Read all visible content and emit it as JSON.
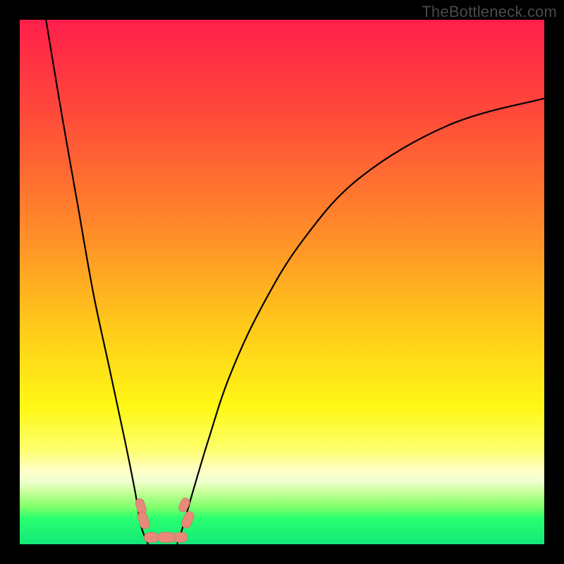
{
  "watermark": "TheBottleneck.com",
  "colors": {
    "black": "#000000",
    "curve": "#000000",
    "blob_fill": "#e88a7a",
    "blob_stroke": "#d97768"
  },
  "chart_data": {
    "type": "line",
    "title": "",
    "xlabel": "",
    "ylabel": "",
    "xlim": [
      0,
      100
    ],
    "ylim": [
      0,
      100
    ],
    "grid": false,
    "series": [
      {
        "name": "left-branch",
        "x": [
          5,
          8,
          11,
          14,
          17,
          20,
          22,
          23,
          24,
          24.5
        ],
        "y": [
          100,
          82,
          65,
          48,
          34,
          20,
          10,
          4,
          1,
          0
        ]
      },
      {
        "name": "right-branch",
        "x": [
          30,
          31,
          33,
          36,
          40,
          46,
          54,
          65,
          82,
          100
        ],
        "y": [
          0,
          3,
          10,
          20,
          32,
          45,
          58,
          70,
          80,
          85
        ]
      }
    ],
    "annotations": [
      {
        "name": "left-blob-cluster",
        "x": 23.5,
        "y": 4
      },
      {
        "name": "right-blob-cluster",
        "x": 31.5,
        "y": 4
      },
      {
        "name": "bottom-blob-cluster",
        "x": 27.5,
        "y": 0.5
      }
    ],
    "gradient_stops": [
      {
        "pct": 0,
        "color": "#ff1f4b"
      },
      {
        "pct": 18,
        "color": "#ff4a3a"
      },
      {
        "pct": 40,
        "color": "#ff8a2a"
      },
      {
        "pct": 58,
        "color": "#ffc81a"
      },
      {
        "pct": 74,
        "color": "#fff815"
      },
      {
        "pct": 82,
        "color": "#feff6e"
      },
      {
        "pct": 86,
        "color": "#ffffc8"
      },
      {
        "pct": 88,
        "color": "#f0ffd0"
      },
      {
        "pct": 90,
        "color": "#c8ff9a"
      },
      {
        "pct": 93,
        "color": "#7cff6a"
      },
      {
        "pct": 95,
        "color": "#2aff6e"
      },
      {
        "pct": 100,
        "color": "#13e879"
      }
    ]
  }
}
